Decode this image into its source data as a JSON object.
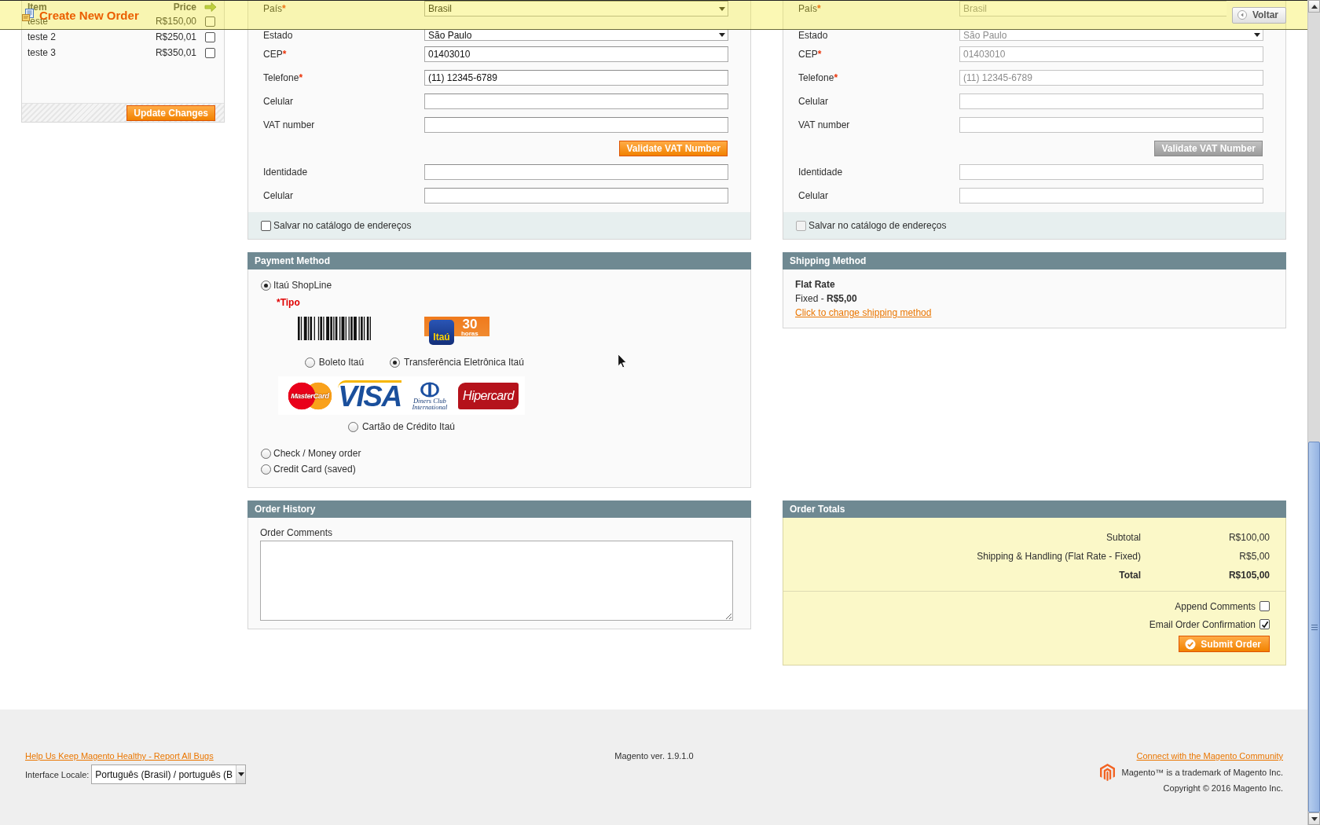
{
  "header": {
    "title": "Create New Order",
    "back_button": "Voltar"
  },
  "items_panel": {
    "columns": [
      "Item",
      "Price"
    ],
    "rows": [
      {
        "name": "teste",
        "price": "R$150,00",
        "checked": false
      },
      {
        "name": "teste 2",
        "price": "R$250,01",
        "checked": false
      },
      {
        "name": "teste 3",
        "price": "R$350,01",
        "checked": false
      }
    ],
    "update_button": "Update Changes"
  },
  "addresses": [
    {
      "disabled": false,
      "fields": [
        {
          "kind": "select",
          "label": "País",
          "mark": "*",
          "value": "Brasil"
        },
        {
          "kind": "select",
          "label": "Estado",
          "value": "São Paulo"
        },
        {
          "kind": "text",
          "label": "CEP",
          "mark": "*",
          "value": "01403010"
        },
        {
          "kind": "text",
          "label": "Telefone",
          "mark": "*",
          "value": "(11) 12345-6789"
        },
        {
          "kind": "text",
          "label": "Celular"
        },
        {
          "kind": "text",
          "label": "VAT number"
        },
        {
          "kind": "button",
          "label": "Validate VAT Number"
        },
        {
          "kind": "text",
          "label": "Identidade"
        },
        {
          "kind": "text",
          "label": "Celular"
        }
      ],
      "save_label": "Salvar no catálogo de endereços",
      "save_checked": false
    },
    {
      "disabled": true,
      "fields": [
        {
          "kind": "select",
          "label": "País",
          "mark": "*",
          "value": "Brasil"
        },
        {
          "kind": "select",
          "label": "Estado",
          "value": "São Paulo"
        },
        {
          "kind": "text",
          "label": "CEP",
          "mark": "*",
          "value": "01403010"
        },
        {
          "kind": "text",
          "label": "Telefone",
          "mark": "*",
          "value": "(11) 12345-6789"
        },
        {
          "kind": "text",
          "label": "Celular"
        },
        {
          "kind": "text",
          "label": "VAT number"
        },
        {
          "kind": "button",
          "label": "Validate VAT Number"
        },
        {
          "kind": "text",
          "label": "Identidade"
        },
        {
          "kind": "text",
          "label": "Celular"
        }
      ],
      "save_label": "Salvar no catálogo de endereços",
      "save_checked": false
    }
  ],
  "payment": {
    "title": "Payment Method",
    "methods": [
      {
        "label": "Itaú ShopLine",
        "selected": true,
        "type_label": "*Tipo",
        "options": [
          {
            "kind": "boleto",
            "label": "Boleto Itaú",
            "selected": false
          },
          {
            "kind": "transfer",
            "label": "Transferência Eletrônica Itaú",
            "selected": true,
            "logo": {
              "brand": "Itaú",
              "number": "30",
              "unit": "horas"
            }
          },
          {
            "kind": "card",
            "label": "Cartão de Crédito Itaú",
            "selected": false,
            "logos": [
              {
                "kind": "mastercard",
                "text": "MasterCard"
              },
              {
                "kind": "visa",
                "text": "VISA"
              },
              {
                "kind": "diners",
                "text": "Diners Club International"
              },
              {
                "kind": "hipercard",
                "text": "Hipercard"
              }
            ]
          }
        ]
      },
      {
        "label": "Check / Money order",
        "selected": false
      },
      {
        "label": "Credit Card (saved)",
        "selected": false
      }
    ]
  },
  "shipping": {
    "title": "Shipping Method",
    "carrier": "Flat Rate",
    "rate": "Fixed - **R$5,00**",
    "change_link": "Click to change shipping method"
  },
  "order_history": {
    "title": "Order History",
    "comments_label": "Order Comments"
  },
  "totals": {
    "title": "Order Totals",
    "rows": [
      {
        "kind": "line",
        "label": "Subtotal",
        "value": "R$100,00"
      },
      {
        "kind": "line",
        "label": "Shipping & Handling (Flat Rate - Fixed)",
        "value": "R$5,00"
      },
      {
        "kind": "grand",
        "label": "Total",
        "value": "R$105,00"
      }
    ],
    "options": [
      {
        "label": "Append Comments",
        "checked": false
      },
      {
        "label": "Email Order Confirmation",
        "checked": true
      }
    ],
    "submit_button": "Submit Order"
  },
  "footer": {
    "bug_link": "Help Us Keep Magento Healthy - Report All Bugs",
    "locale_label": "Interface Locale:",
    "locale_value": "Português (Brasil) / português (B",
    "version": "Magento ver. 1.9.1.0",
    "community_link": "Connect with the Magento Community",
    "trademark": "Magento™ is a trademark of Magento Inc.",
    "copyright": "Copyright © 2016 Magento Inc."
  }
}
